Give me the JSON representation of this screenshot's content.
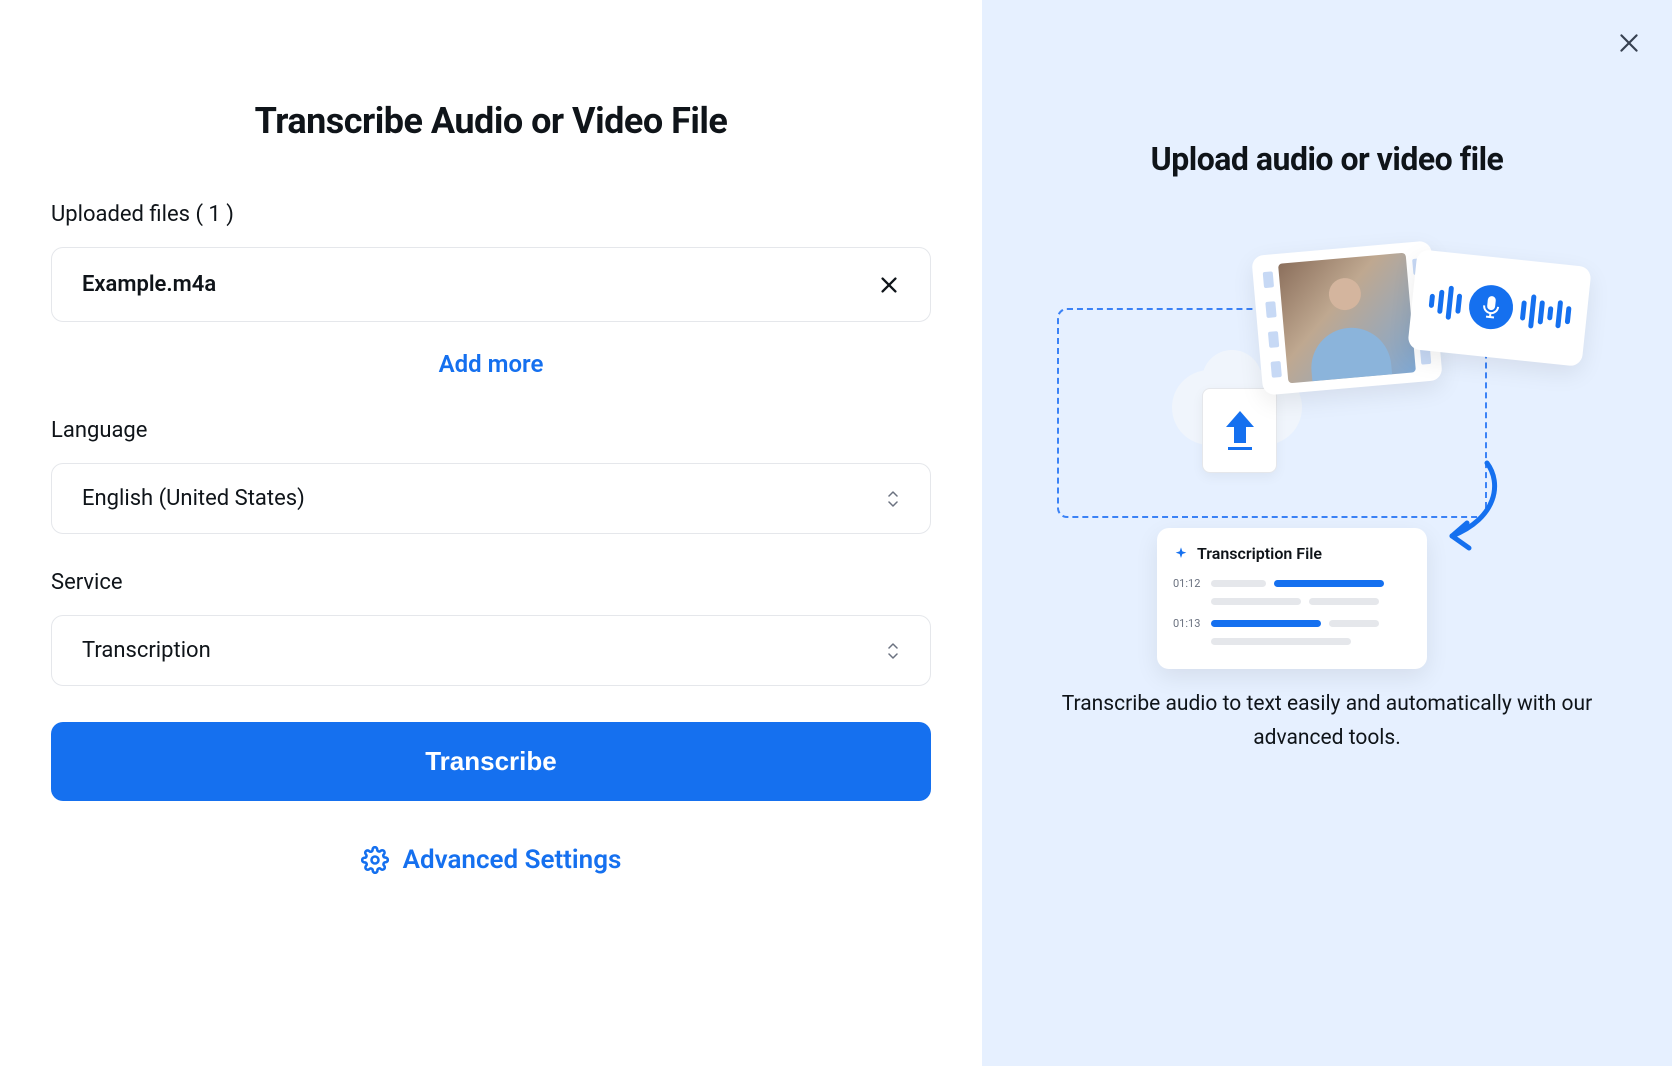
{
  "left": {
    "title": "Transcribe Audio or Video File",
    "uploaded_label": "Uploaded files ( 1 )",
    "file_name": "Example.m4a",
    "add_more": "Add more",
    "language_label": "Language",
    "language_value": "English (United States)",
    "service_label": "Service",
    "service_value": "Transcription",
    "transcribe_btn": "Transcribe",
    "advanced_settings": "Advanced Settings"
  },
  "right": {
    "title": "Upload audio or video file",
    "trans_card_title": "Transcription File",
    "time1": "01:12",
    "time2": "01:13",
    "description": "Transcribe audio to text easily and automatically with our advanced tools."
  }
}
